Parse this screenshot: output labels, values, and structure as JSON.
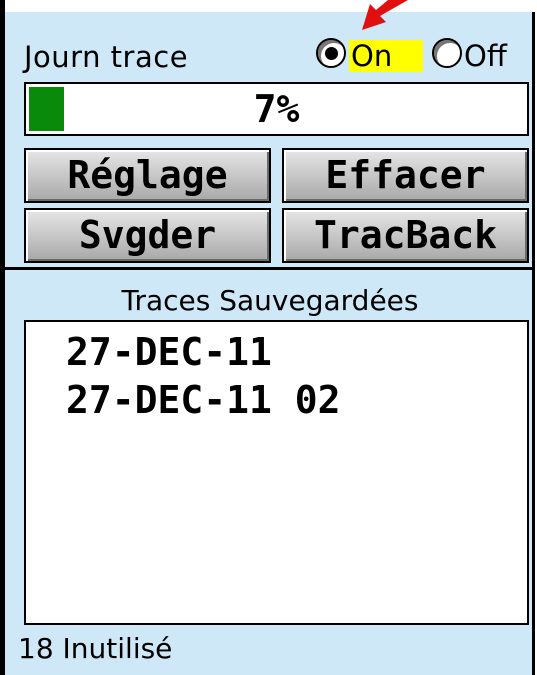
{
  "track_log": {
    "label": "Journ trace",
    "options": {
      "on": "On",
      "off": "Off"
    },
    "selected": "On"
  },
  "progress": {
    "percent_text": "7%",
    "fill_fraction": 0.07
  },
  "buttons": {
    "setup": "Réglage",
    "clear": "Effacer",
    "save": "Svgder",
    "trackback": "TracBack"
  },
  "saved_tracks": {
    "title": "Traces Sauvegardées",
    "items": [
      "27-DEC-11",
      "27-DEC-11 02"
    ]
  },
  "footer": {
    "unused": "18 Inutilisé"
  },
  "colors": {
    "background": "#cfe8f8",
    "progress_fill": "#0a8a0a",
    "highlight": "#ffff00",
    "arrow": "#e01010"
  },
  "icons": {
    "annotation_arrow": "red-arrow-icon"
  }
}
